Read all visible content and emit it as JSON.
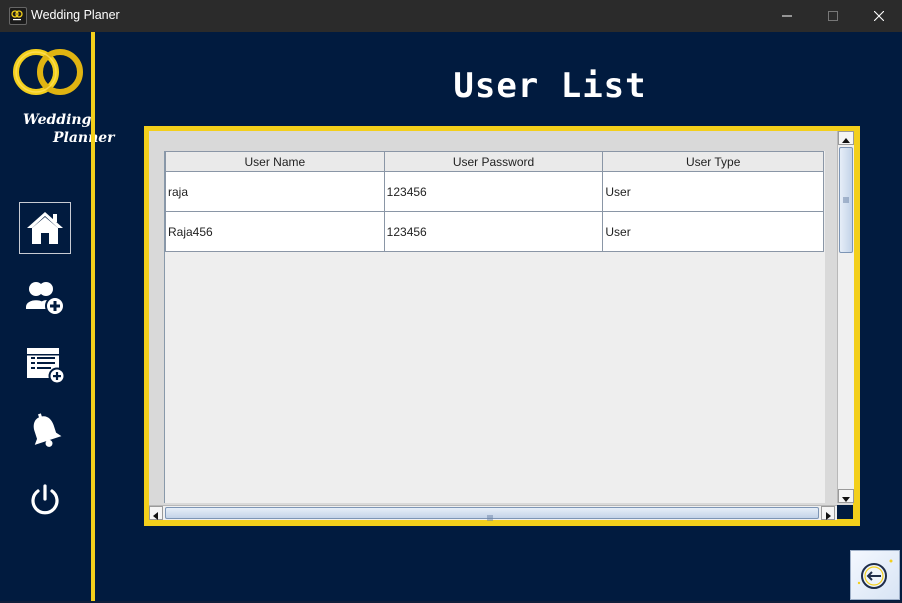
{
  "window": {
    "title": "Wedding Planer",
    "controls": [
      "minimize-icon",
      "maximize-icon",
      "close-icon"
    ]
  },
  "sidebar": {
    "logo": {
      "line1": "Wedding",
      "line2": "Planner"
    },
    "items": [
      {
        "icon": "home-icon",
        "active": true
      },
      {
        "icon": "add-user-icon"
      },
      {
        "icon": "add-list-icon"
      },
      {
        "icon": "bell-icon"
      },
      {
        "icon": "power-icon"
      }
    ]
  },
  "page": {
    "title": "User List"
  },
  "table": {
    "columns": [
      "User Name",
      "User Password",
      "User Type"
    ],
    "rows": [
      [
        "raja",
        "123456",
        "User"
      ],
      [
        "Raja456",
        "123456",
        "User"
      ]
    ]
  },
  "back_button": {
    "icon": "back-arrow-icon"
  },
  "colors": {
    "accent": "#f3cf1b",
    "background": "#011b3f",
    "titlebar": "#2b2b2b"
  }
}
